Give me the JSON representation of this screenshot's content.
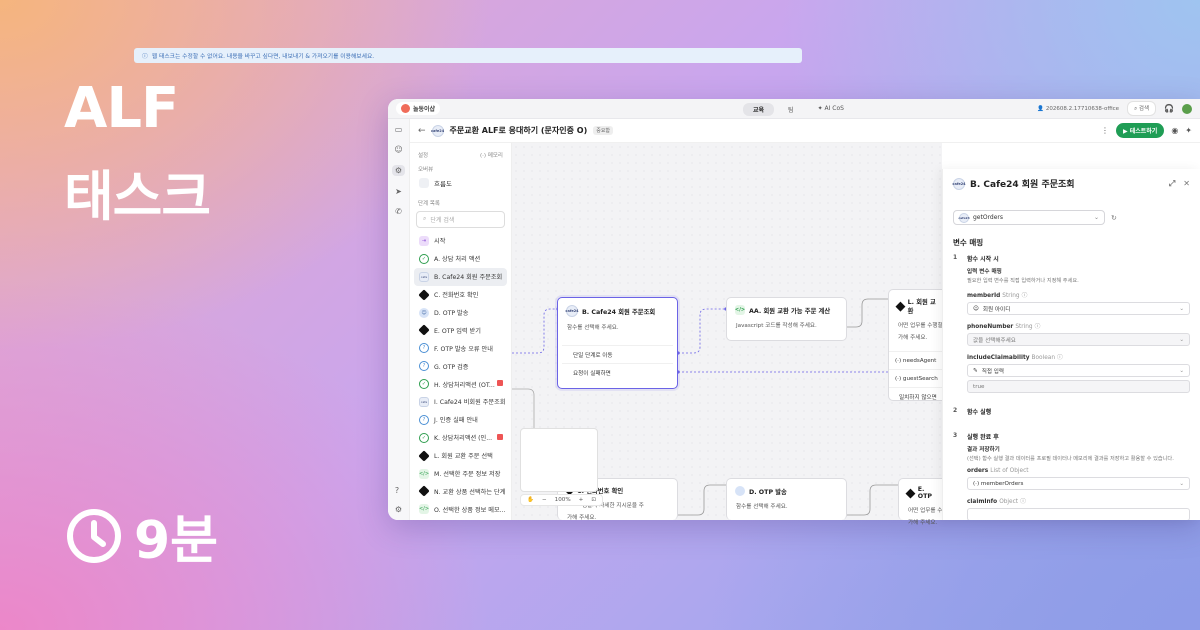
{
  "hero": {
    "title1": "ALF",
    "title2": "태스크",
    "time": "9분"
  },
  "topbar": {
    "brand": "놀동이샵",
    "tabs": [
      "교육",
      "팀",
      "✦ AI CoS"
    ],
    "workspace": "202608.2.17710638-office",
    "search": "검색"
  },
  "header": {
    "title": "주문교환 ALF로 응대하기 (문자인증 O)",
    "badge": "중요함",
    "test_label": "테스트하기"
  },
  "sidebar": {
    "settings_label": "설정",
    "memo_label": "메모리",
    "overview_label": "오버뷰",
    "flow_label": "흐름도",
    "steps_label": "단계 목록",
    "search_placeholder": "단계 검색",
    "steps": [
      {
        "label": "시작",
        "icon": "start"
      },
      {
        "label": "A. 상담 처리 액션",
        "icon": "msg"
      },
      {
        "label": "B. Cafe24 회원 주문조회",
        "icon": "cafe",
        "selected": true
      },
      {
        "label": "C. 전화번호 확인",
        "icon": "ai"
      },
      {
        "label": "D. OTP 발송",
        "icon": "user"
      },
      {
        "label": "E. OTP 입력 받기",
        "icon": "ai"
      },
      {
        "label": "F. OTP 발송 오류 안내",
        "icon": "q"
      },
      {
        "label": "G. OTP 검증",
        "icon": "q"
      },
      {
        "label": "H. 상담처리액션 (OT...",
        "icon": "msg",
        "flag": true
      },
      {
        "label": "I. Cafe24 비회원 주문조회",
        "icon": "cafe"
      },
      {
        "label": "J. 인증 실패 안내",
        "icon": "q"
      },
      {
        "label": "K. 상담처리액션 (인...",
        "icon": "msg",
        "flag": true
      },
      {
        "label": "L. 회원 교환 주문 선택",
        "icon": "ai"
      },
      {
        "label": "M. 선택한 주문 정보 저장",
        "icon": "js"
      },
      {
        "label": "N. 교환 상품 선택하는 단계",
        "icon": "ai"
      },
      {
        "label": "O. 선택한 상품 정보 메모...",
        "icon": "js"
      }
    ]
  },
  "canvas": {
    "notice": "웹 태스크는 수정할 수 없어요. 내용을 바꾸고 싶다면, 내보내기 & 가져오기를 이용해보세요.",
    "node_b": {
      "title": "B. Cafe24 회원 주문조회",
      "desc": "함수를 선택해 주세요.",
      "row1": "단일 단계로 이동",
      "row2": "요청이 실패하면"
    },
    "node_aa": {
      "title": "AA. 회원 교환 가능 주문 계산",
      "desc": "Javascript 코드를 작성해 주세요."
    },
    "node_l": {
      "title": "L. 회원 교환",
      "desc": "어떤 업무를 수행할",
      "desc2": "가해 주세요.",
      "row1": "(·) needsAgent",
      "row2": "(·) guestSearch",
      "row3": "일치하지 않으면"
    },
    "node_c": {
      "title": "C. 전화번호 확인",
      "desc": "행할지 자세한 지시문을 주",
      "desc2": "가해 주세요."
    },
    "node_d": {
      "title": "D. OTP 발송",
      "desc": "함수를 선택해 주세요."
    },
    "node_e": {
      "title": "E. OTP",
      "desc": "어떤 업무를 수",
      "desc2": "가해 주세요."
    },
    "zoom": "100%"
  },
  "panel": {
    "title": "B.  Cafe24 회원 주문조회",
    "function": "getOrders",
    "mapping_title": "변수 매핑",
    "step1_num": "1",
    "step1_title": "함수 시작 시",
    "step1_sub": "입력 변수 매핑",
    "step1_hint": "필요한 입력 변수를 직접 입력하거나 지정해 주세요.",
    "f1_name": "memberId",
    "f1_type": "String",
    "f1_value": "회원 아이디",
    "f2_name": "phoneNumber",
    "f2_type": "String",
    "f2_value": "값을 선택해주세요",
    "f3_name": "includeClaimability",
    "f3_type": "Boolean",
    "f3_value": "직접 입력",
    "f3_input": "true",
    "step2_num": "2",
    "step2_title": "함수 실행",
    "step3_num": "3",
    "step3_title": "실행 완료 후",
    "step3_sub": "결과 저장하기",
    "step3_hint": "(선택) 함수 실행 결과 데이터를 프로필 데이터나 메모리에 결과를 저장하고 활용할 수 있습니다.",
    "f4_name": "orders",
    "f4_type": "List of Object",
    "f4_value": "(·) memberOrders",
    "f5_name": "claimInfo",
    "f5_type": "Object"
  },
  "colors": {
    "accent": "#6b63e6",
    "test": "#1f9d55",
    "notice": "#3d6fb6"
  }
}
